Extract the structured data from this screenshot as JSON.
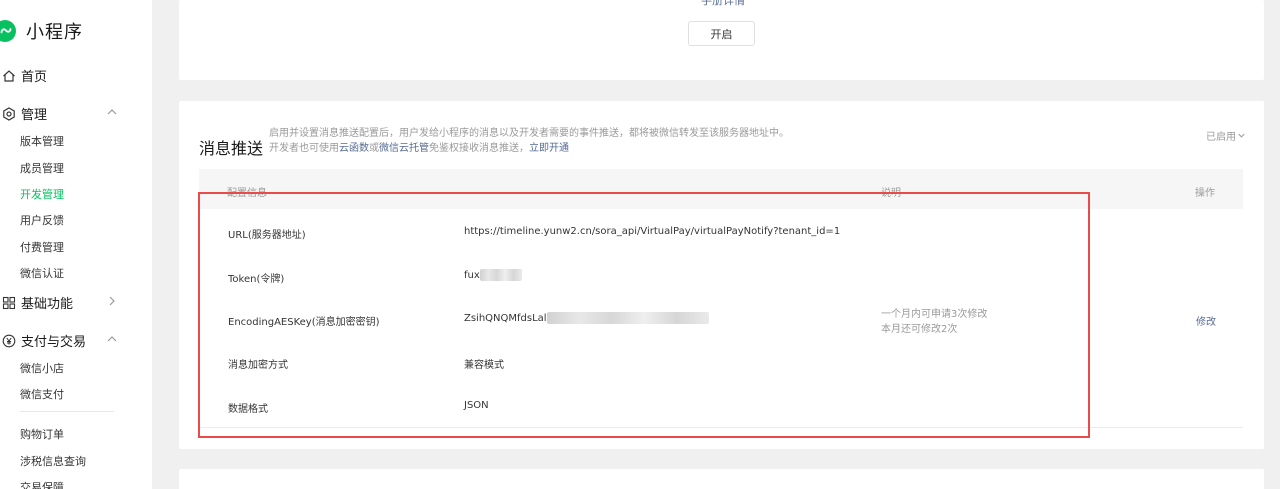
{
  "app": {
    "name": "小程序",
    "logo_icon": "miniprogram-logo-icon",
    "accent_color": "#07c160"
  },
  "sidebar": {
    "home": {
      "label": "首页",
      "icon": "home-icon"
    },
    "manage": {
      "label": "管理",
      "icon": "gear-icon",
      "expanded": true,
      "items": [
        {
          "label": "版本管理"
        },
        {
          "label": "成员管理"
        },
        {
          "label": "开发管理",
          "active": true
        },
        {
          "label": "用户反馈"
        },
        {
          "label": "付费管理"
        },
        {
          "label": "微信认证"
        }
      ]
    },
    "basic": {
      "label": "基础功能",
      "icon": "grid-icon",
      "expanded": false
    },
    "payment": {
      "label": "支付与交易",
      "icon": "yen-icon",
      "expanded": true,
      "items": [
        {
          "label": "微信小店"
        },
        {
          "label": "微信支付"
        },
        {
          "label": "购物订单"
        },
        {
          "label": "涉税信息查询"
        },
        {
          "label": "交易保障"
        }
      ]
    }
  },
  "top_card": {
    "cut_link": "手册详情",
    "open_button": "开启"
  },
  "push": {
    "title": "消息推送",
    "desc_line1": "启用并设置消息推送配置后，用户发给小程序的消息以及开发者需要的事件推送，都将被微信转发至该服务器地址中。",
    "desc_line2_prefix": "开发者也可使用",
    "desc_link_cloud_func": "云函数",
    "desc_or": "或",
    "desc_link_cloud_host": "微信云托管",
    "desc_line2_suffix": "免鉴权接收消息推送，",
    "desc_link_open": "立即开通",
    "status": "已启用",
    "table": {
      "headers": {
        "config": "配置信息",
        "desc": "说明",
        "action": "操作"
      },
      "rows": [
        {
          "label": "URL(服务器地址)",
          "value": "https://timeline.yunw2.cn/sora_api/VirtualPay/virtualPayNotify?tenant_id=1"
        },
        {
          "label": "Token(令牌)",
          "value": "fux"
        },
        {
          "label": "EncodingAESKey(消息加密密钥)",
          "value": "ZsihQNQMfdsLal"
        },
        {
          "label": "消息加密方式",
          "value": "兼容模式"
        },
        {
          "label": "数据格式",
          "value": "JSON"
        }
      ],
      "aes_note_line1": "一个月内可申请3次修改",
      "aes_note_line2": "本月还可修改2次",
      "modify": "修改"
    }
  },
  "highlight_color": "#e94b4b"
}
